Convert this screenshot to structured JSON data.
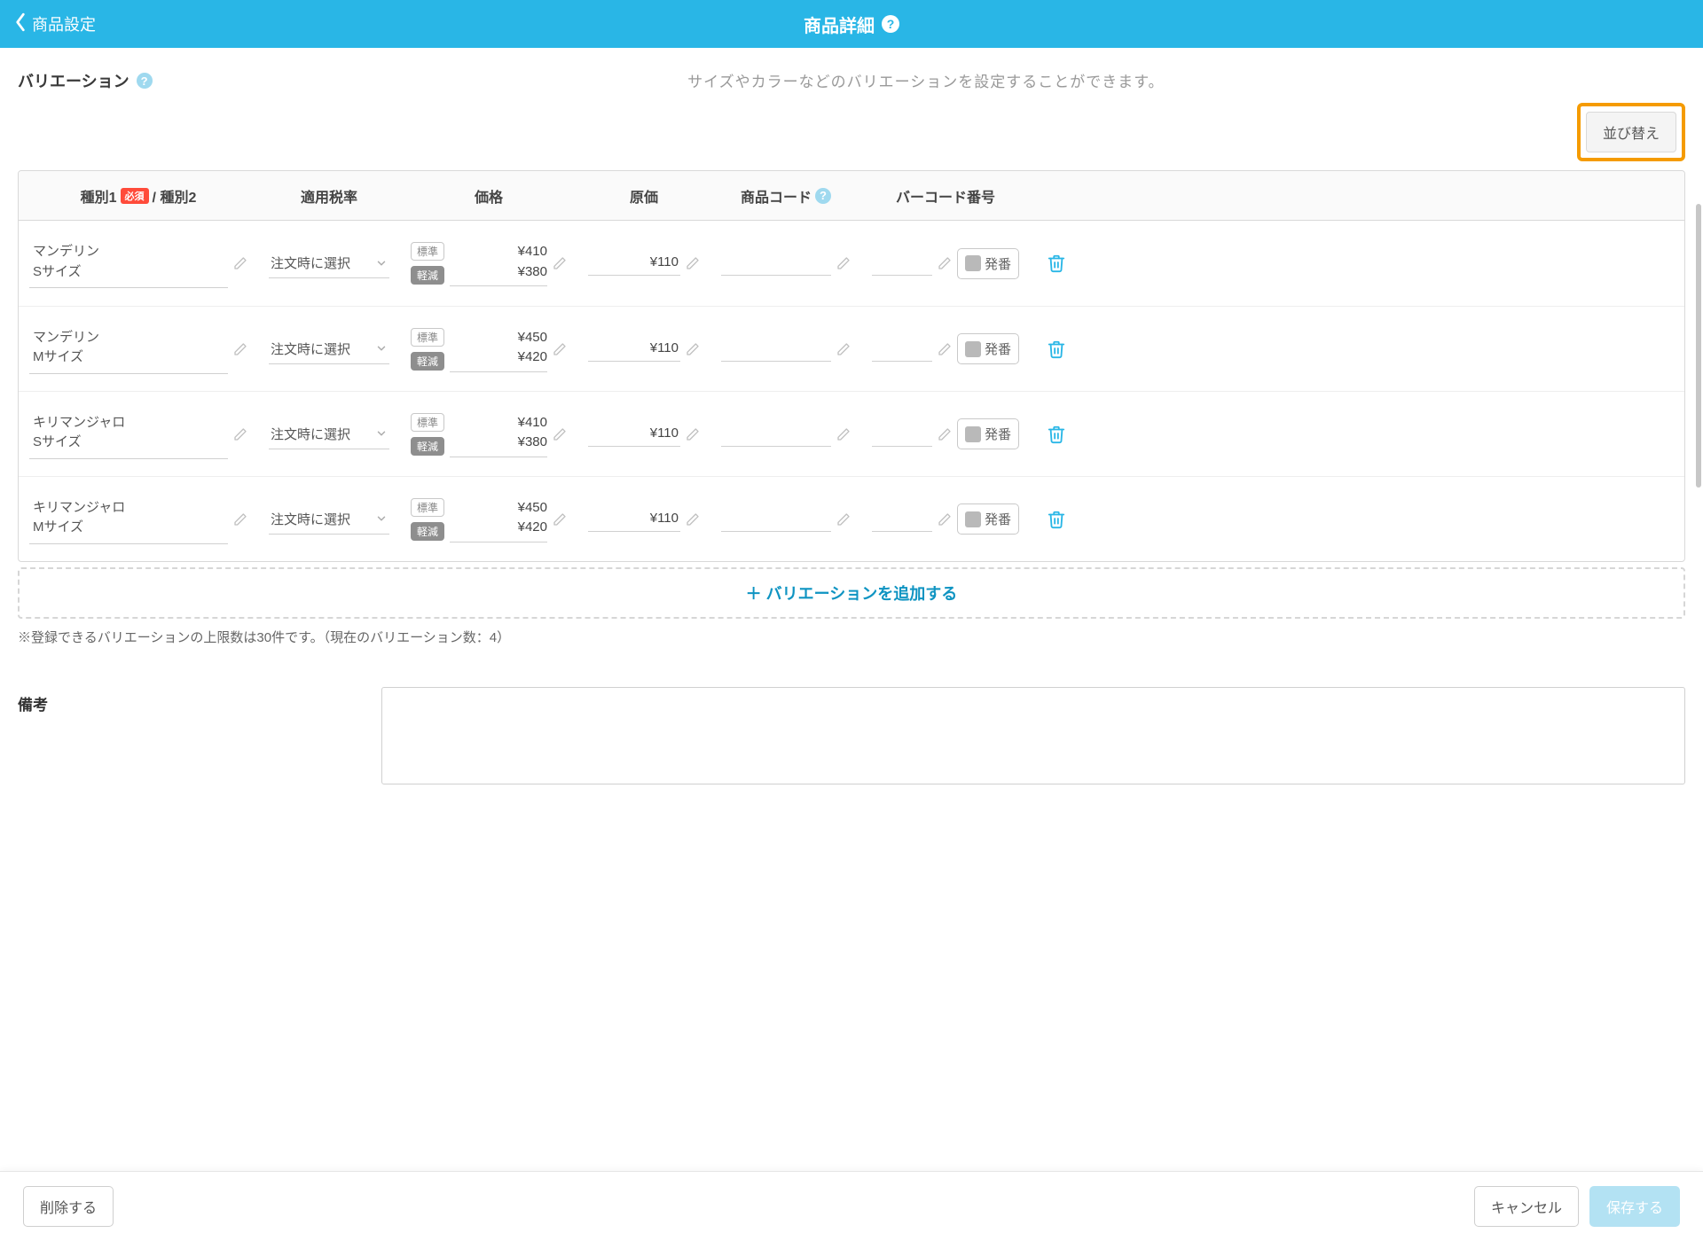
{
  "header": {
    "back_label": "商品設定",
    "title": "商品詳細"
  },
  "section": {
    "title": "バリエーション",
    "description": "サイズやカラーなどのバリエーションを設定することができます。",
    "sort_button": "並び替え"
  },
  "table": {
    "headers": {
      "type1": "種別1",
      "required": "必須",
      "type2_sep": "/ 種別2",
      "tax": "適用税率",
      "price": "価格",
      "cost": "原価",
      "code": "商品コード",
      "barcode": "バーコード番号"
    },
    "price_tags": {
      "standard": "標準",
      "reduced": "軽減"
    },
    "issue_label": "発番",
    "rows": [
      {
        "type_line1": "マンデリン",
        "type_line2": "Sサイズ",
        "tax": "注文時に選択",
        "price_std": "¥410",
        "price_red": "¥380",
        "cost": "¥110"
      },
      {
        "type_line1": "マンデリン",
        "type_line2": "Mサイズ",
        "tax": "注文時に選択",
        "price_std": "¥450",
        "price_red": "¥420",
        "cost": "¥110"
      },
      {
        "type_line1": "キリマンジャロ",
        "type_line2": "Sサイズ",
        "tax": "注文時に選択",
        "price_std": "¥410",
        "price_red": "¥380",
        "cost": "¥110"
      },
      {
        "type_line1": "キリマンジャロ",
        "type_line2": "Mサイズ",
        "tax": "注文時に選択",
        "price_std": "¥450",
        "price_red": "¥420",
        "cost": "¥110"
      }
    ]
  },
  "add_variation": "＋ バリエーションを追加する",
  "limit_note": "※登録できるバリエーションの上限数は30件です。（現在のバリエーション数：4）",
  "remarks_label": "備考",
  "footer": {
    "delete": "削除する",
    "cancel": "キャンセル",
    "save": "保存する"
  }
}
